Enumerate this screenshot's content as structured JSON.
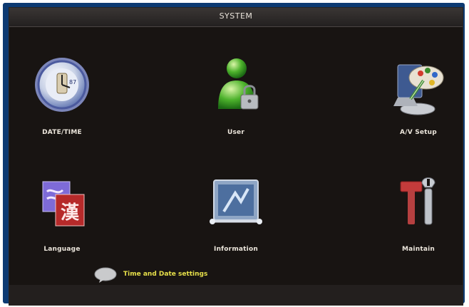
{
  "window": {
    "title": "SYSTEM"
  },
  "menu": {
    "items": [
      {
        "label": "DATE/TIME",
        "icon": "clock-icon"
      },
      {
        "label": "User",
        "icon": "user-icon"
      },
      {
        "label": "A/V Setup",
        "icon": "av-setup-icon"
      },
      {
        "label": "Language",
        "icon": "language-icon"
      },
      {
        "label": "Information",
        "icon": "information-icon"
      },
      {
        "label": "Maintain",
        "icon": "maintain-icon"
      }
    ]
  },
  "status": {
    "text": "Time and Date settings",
    "icon": "speech-bubble-icon"
  },
  "colors": {
    "screen_border": "#0d3a72",
    "window_bg": "#181412",
    "label_text": "#ece6dc",
    "status_text": "#e7e04a"
  }
}
